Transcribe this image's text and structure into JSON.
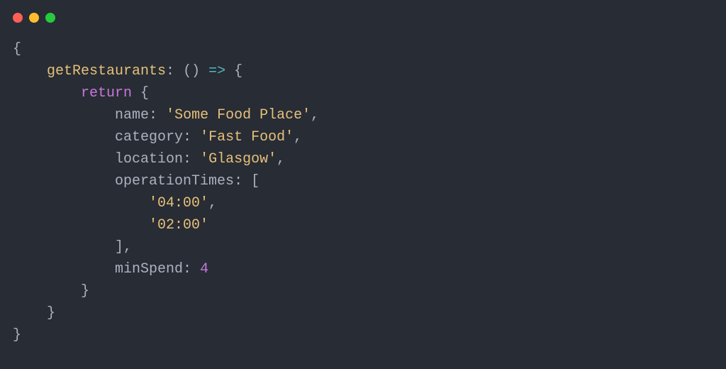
{
  "window": {
    "traffic_colors": {
      "close": "#ff5f56",
      "minimize": "#ffbd2e",
      "zoom": "#27c93f"
    }
  },
  "code": {
    "fnName": "getRestaurants",
    "arrow": "=>",
    "returnKw": "return",
    "props": {
      "nameKey": "name",
      "nameVal": "'Some Food Place'",
      "categoryKey": "category",
      "categoryVal": "'Fast Food'",
      "locationKey": "location",
      "locationVal": "'Glasgow'",
      "opTimesKey": "operationTimes",
      "opTime0": "'04:00'",
      "opTime1": "'02:00'",
      "minSpendKey": "minSpend",
      "minSpendVal": "4"
    },
    "punct": {
      "lbrace": "{",
      "rbrace": "}",
      "lparen": "(",
      "rparen": ")",
      "lbracket": "[",
      "rbracket": "]",
      "colon": ":",
      "comma": ","
    }
  }
}
